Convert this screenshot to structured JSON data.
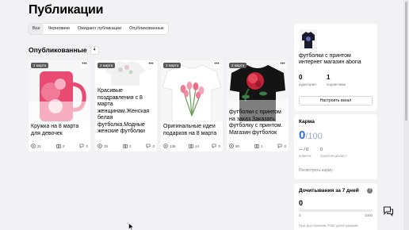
{
  "page": {
    "title": "Публикации"
  },
  "tabs": [
    {
      "label": "Все"
    },
    {
      "label": "Черновики"
    },
    {
      "label": "Ожидают публикации"
    },
    {
      "label": "Опубликованные"
    }
  ],
  "section": {
    "title": "Опубликованные",
    "count": "4"
  },
  "cards": [
    {
      "badge": "2 марта",
      "more": "•••",
      "title": "Кружка на 8 марта для девочек",
      "views": "31",
      "reads": "2",
      "comments": "0"
    },
    {
      "badge": "2 марта",
      "more": "•••",
      "title": "Красивые поздравления с 8 марта женщинам.Женская белая футболка.Модные женские футболки",
      "views": "35",
      "reads": "2",
      "comments": "0"
    },
    {
      "badge": "2 марта",
      "more": "•••",
      "title": "Оригинальные идеи подарков на 8 марта",
      "views": "136",
      "reads": "14",
      "comments": "0"
    },
    {
      "badge": "2 марта",
      "more": "•••",
      "title": "футболки с принтом на заказ.Заказать футболку с принтом. Магазин футболок",
      "views": "80",
      "reads": "1",
      "comments": "0"
    }
  ],
  "profile": {
    "name": "футболки с принтом интернет магазин abona",
    "audience_value": "0",
    "audience_label": "аудитория",
    "subscribers_value": "1",
    "subscribers_label": "подписчики",
    "setup_button": "Настроить канал"
  },
  "karma": {
    "title": "Карма",
    "value": "0",
    "max": "/100",
    "new_value": "— / 0",
    "new_label": "новичок",
    "expert_value": "0",
    "expert_label": "Зона/специалист",
    "link": "Посмотреть карму"
  },
  "reach": {
    "title": "Дочитывания за 7 дней",
    "help": "?",
    "value": "0",
    "min": "0",
    "max": "1000",
    "progress": 0,
    "note": "При достижении 7000 дочитываний"
  },
  "colors": {
    "accent": "#2d6cf0",
    "background": "#f2f2f4",
    "card": "#ffffff"
  },
  "icons": {
    "views": "eye-icon",
    "reads": "book-icon",
    "comments": "comment-icon",
    "chat": "chat-icon"
  }
}
